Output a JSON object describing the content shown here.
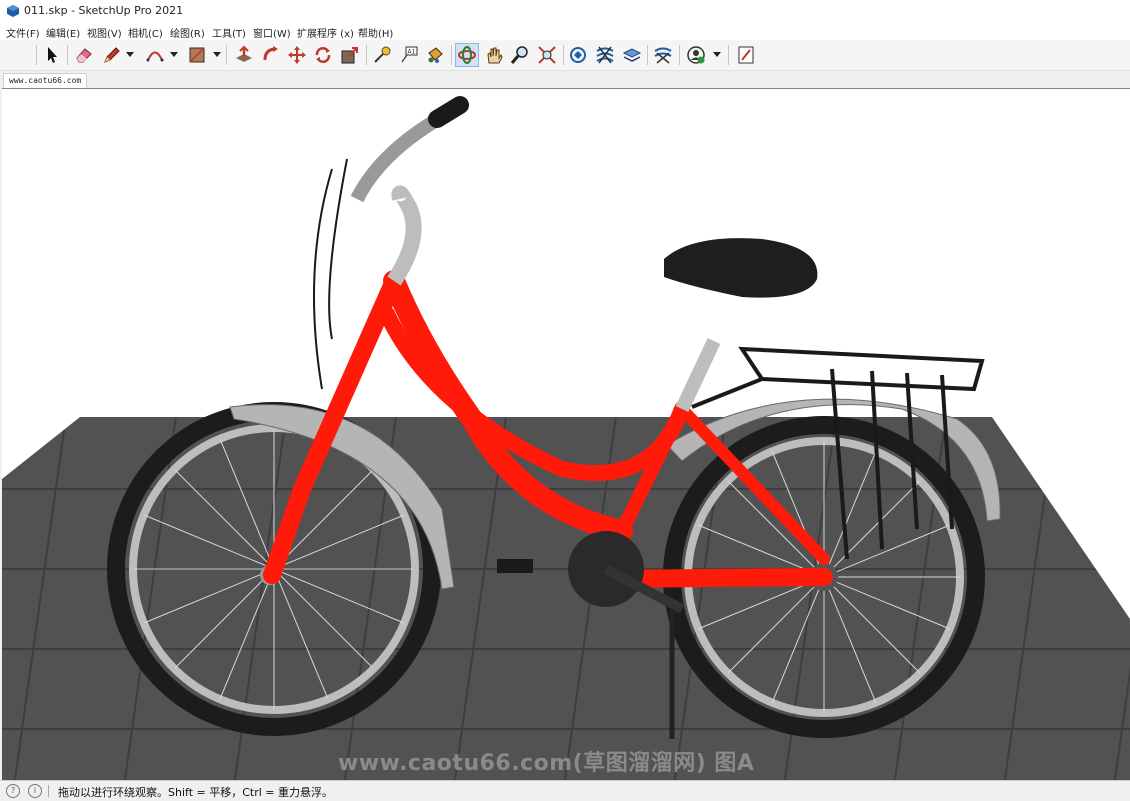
{
  "window": {
    "title": "011.skp - SketchUp Pro 2021"
  },
  "menu": [
    {
      "name": "menu-file",
      "label": "文件(F)"
    },
    {
      "name": "menu-edit",
      "label": "编辑(E)"
    },
    {
      "name": "menu-view",
      "label": "视图(V)"
    },
    {
      "name": "menu-camera",
      "label": "相机(C)"
    },
    {
      "name": "menu-draw",
      "label": "绘图(R)"
    },
    {
      "name": "menu-tools",
      "label": "工具(T)"
    },
    {
      "name": "menu-window",
      "label": "窗口(W)"
    },
    {
      "name": "menu-extensions",
      "label": "扩展程序 (x)"
    },
    {
      "name": "menu-help",
      "label": "帮助(H)"
    }
  ],
  "toolbar": {
    "tools": [
      {
        "name": "select-tool-icon",
        "active": false
      },
      {
        "name": "eraser-tool-icon",
        "active": false
      },
      {
        "name": "pencil-line-tool-icon",
        "active": false
      },
      {
        "name": "arc-tool-icon",
        "active": false
      },
      {
        "name": "rectangle-tool-icon",
        "active": false
      },
      {
        "name": "push-pull-tool-icon",
        "active": false
      },
      {
        "name": "follow-me-tool-icon",
        "active": false
      },
      {
        "name": "move-tool-icon",
        "active": false
      },
      {
        "name": "rotate-tool-icon",
        "active": false
      },
      {
        "name": "scale-tool-icon",
        "active": false
      },
      {
        "name": "tape-measure-tool-icon",
        "active": false
      },
      {
        "name": "text-tool-icon",
        "active": false
      },
      {
        "name": "paint-bucket-tool-icon",
        "active": false
      },
      {
        "name": "orbit-tool-icon",
        "active": true
      },
      {
        "name": "pan-tool-icon",
        "active": false
      },
      {
        "name": "zoom-tool-icon",
        "active": false
      },
      {
        "name": "zoom-extents-tool-icon",
        "active": false
      },
      {
        "name": "warehouse-icon",
        "active": false
      },
      {
        "name": "extension-warehouse-icon",
        "active": false
      },
      {
        "name": "layout-send-icon",
        "active": false
      },
      {
        "name": "extension-manager-icon",
        "active": false
      },
      {
        "name": "user-account-icon",
        "active": false
      },
      {
        "name": "layout-doc-icon",
        "active": false
      }
    ]
  },
  "scene_tabs": [
    {
      "label": "www.caotu66.com"
    }
  ],
  "viewport": {
    "model": "bicycle",
    "frame_color": "#ff0000",
    "ground_color": "#4a4a4a"
  },
  "watermark": "www.caotu66.com(草图溜溜网) 图A",
  "status": {
    "message": "拖动以进行环绕观察。Shift = 平移，Ctrl = 重力悬浮。"
  }
}
